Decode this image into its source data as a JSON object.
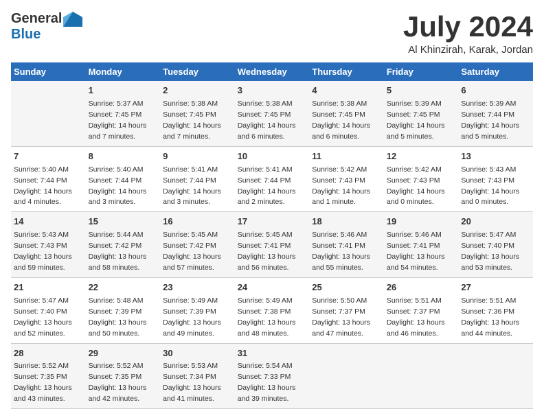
{
  "logo": {
    "general": "General",
    "blue": "Blue"
  },
  "title": "July 2024",
  "location": "Al Khinzirah, Karak, Jordan",
  "days_of_week": [
    "Sunday",
    "Monday",
    "Tuesday",
    "Wednesday",
    "Thursday",
    "Friday",
    "Saturday"
  ],
  "weeks": [
    [
      {
        "num": "",
        "sunrise": "",
        "sunset": "",
        "daylight": ""
      },
      {
        "num": "1",
        "sunrise": "Sunrise: 5:37 AM",
        "sunset": "Sunset: 7:45 PM",
        "daylight": "Daylight: 14 hours and 7 minutes."
      },
      {
        "num": "2",
        "sunrise": "Sunrise: 5:38 AM",
        "sunset": "Sunset: 7:45 PM",
        "daylight": "Daylight: 14 hours and 7 minutes."
      },
      {
        "num": "3",
        "sunrise": "Sunrise: 5:38 AM",
        "sunset": "Sunset: 7:45 PM",
        "daylight": "Daylight: 14 hours and 6 minutes."
      },
      {
        "num": "4",
        "sunrise": "Sunrise: 5:38 AM",
        "sunset": "Sunset: 7:45 PM",
        "daylight": "Daylight: 14 hours and 6 minutes."
      },
      {
        "num": "5",
        "sunrise": "Sunrise: 5:39 AM",
        "sunset": "Sunset: 7:45 PM",
        "daylight": "Daylight: 14 hours and 5 minutes."
      },
      {
        "num": "6",
        "sunrise": "Sunrise: 5:39 AM",
        "sunset": "Sunset: 7:44 PM",
        "daylight": "Daylight: 14 hours and 5 minutes."
      }
    ],
    [
      {
        "num": "7",
        "sunrise": "Sunrise: 5:40 AM",
        "sunset": "Sunset: 7:44 PM",
        "daylight": "Daylight: 14 hours and 4 minutes."
      },
      {
        "num": "8",
        "sunrise": "Sunrise: 5:40 AM",
        "sunset": "Sunset: 7:44 PM",
        "daylight": "Daylight: 14 hours and 3 minutes."
      },
      {
        "num": "9",
        "sunrise": "Sunrise: 5:41 AM",
        "sunset": "Sunset: 7:44 PM",
        "daylight": "Daylight: 14 hours and 3 minutes."
      },
      {
        "num": "10",
        "sunrise": "Sunrise: 5:41 AM",
        "sunset": "Sunset: 7:44 PM",
        "daylight": "Daylight: 14 hours and 2 minutes."
      },
      {
        "num": "11",
        "sunrise": "Sunrise: 5:42 AM",
        "sunset": "Sunset: 7:43 PM",
        "daylight": "Daylight: 14 hours and 1 minute."
      },
      {
        "num": "12",
        "sunrise": "Sunrise: 5:42 AM",
        "sunset": "Sunset: 7:43 PM",
        "daylight": "Daylight: 14 hours and 0 minutes."
      },
      {
        "num": "13",
        "sunrise": "Sunrise: 5:43 AM",
        "sunset": "Sunset: 7:43 PM",
        "daylight": "Daylight: 14 hours and 0 minutes."
      }
    ],
    [
      {
        "num": "14",
        "sunrise": "Sunrise: 5:43 AM",
        "sunset": "Sunset: 7:43 PM",
        "daylight": "Daylight: 13 hours and 59 minutes."
      },
      {
        "num": "15",
        "sunrise": "Sunrise: 5:44 AM",
        "sunset": "Sunset: 7:42 PM",
        "daylight": "Daylight: 13 hours and 58 minutes."
      },
      {
        "num": "16",
        "sunrise": "Sunrise: 5:45 AM",
        "sunset": "Sunset: 7:42 PM",
        "daylight": "Daylight: 13 hours and 57 minutes."
      },
      {
        "num": "17",
        "sunrise": "Sunrise: 5:45 AM",
        "sunset": "Sunset: 7:41 PM",
        "daylight": "Daylight: 13 hours and 56 minutes."
      },
      {
        "num": "18",
        "sunrise": "Sunrise: 5:46 AM",
        "sunset": "Sunset: 7:41 PM",
        "daylight": "Daylight: 13 hours and 55 minutes."
      },
      {
        "num": "19",
        "sunrise": "Sunrise: 5:46 AM",
        "sunset": "Sunset: 7:41 PM",
        "daylight": "Daylight: 13 hours and 54 minutes."
      },
      {
        "num": "20",
        "sunrise": "Sunrise: 5:47 AM",
        "sunset": "Sunset: 7:40 PM",
        "daylight": "Daylight: 13 hours and 53 minutes."
      }
    ],
    [
      {
        "num": "21",
        "sunrise": "Sunrise: 5:47 AM",
        "sunset": "Sunset: 7:40 PM",
        "daylight": "Daylight: 13 hours and 52 minutes."
      },
      {
        "num": "22",
        "sunrise": "Sunrise: 5:48 AM",
        "sunset": "Sunset: 7:39 PM",
        "daylight": "Daylight: 13 hours and 50 minutes."
      },
      {
        "num": "23",
        "sunrise": "Sunrise: 5:49 AM",
        "sunset": "Sunset: 7:39 PM",
        "daylight": "Daylight: 13 hours and 49 minutes."
      },
      {
        "num": "24",
        "sunrise": "Sunrise: 5:49 AM",
        "sunset": "Sunset: 7:38 PM",
        "daylight": "Daylight: 13 hours and 48 minutes."
      },
      {
        "num": "25",
        "sunrise": "Sunrise: 5:50 AM",
        "sunset": "Sunset: 7:37 PM",
        "daylight": "Daylight: 13 hours and 47 minutes."
      },
      {
        "num": "26",
        "sunrise": "Sunrise: 5:51 AM",
        "sunset": "Sunset: 7:37 PM",
        "daylight": "Daylight: 13 hours and 46 minutes."
      },
      {
        "num": "27",
        "sunrise": "Sunrise: 5:51 AM",
        "sunset": "Sunset: 7:36 PM",
        "daylight": "Daylight: 13 hours and 44 minutes."
      }
    ],
    [
      {
        "num": "28",
        "sunrise": "Sunrise: 5:52 AM",
        "sunset": "Sunset: 7:35 PM",
        "daylight": "Daylight: 13 hours and 43 minutes."
      },
      {
        "num": "29",
        "sunrise": "Sunrise: 5:52 AM",
        "sunset": "Sunset: 7:35 PM",
        "daylight": "Daylight: 13 hours and 42 minutes."
      },
      {
        "num": "30",
        "sunrise": "Sunrise: 5:53 AM",
        "sunset": "Sunset: 7:34 PM",
        "daylight": "Daylight: 13 hours and 41 minutes."
      },
      {
        "num": "31",
        "sunrise": "Sunrise: 5:54 AM",
        "sunset": "Sunset: 7:33 PM",
        "daylight": "Daylight: 13 hours and 39 minutes."
      },
      {
        "num": "",
        "sunrise": "",
        "sunset": "",
        "daylight": ""
      },
      {
        "num": "",
        "sunrise": "",
        "sunset": "",
        "daylight": ""
      },
      {
        "num": "",
        "sunrise": "",
        "sunset": "",
        "daylight": ""
      }
    ]
  ]
}
